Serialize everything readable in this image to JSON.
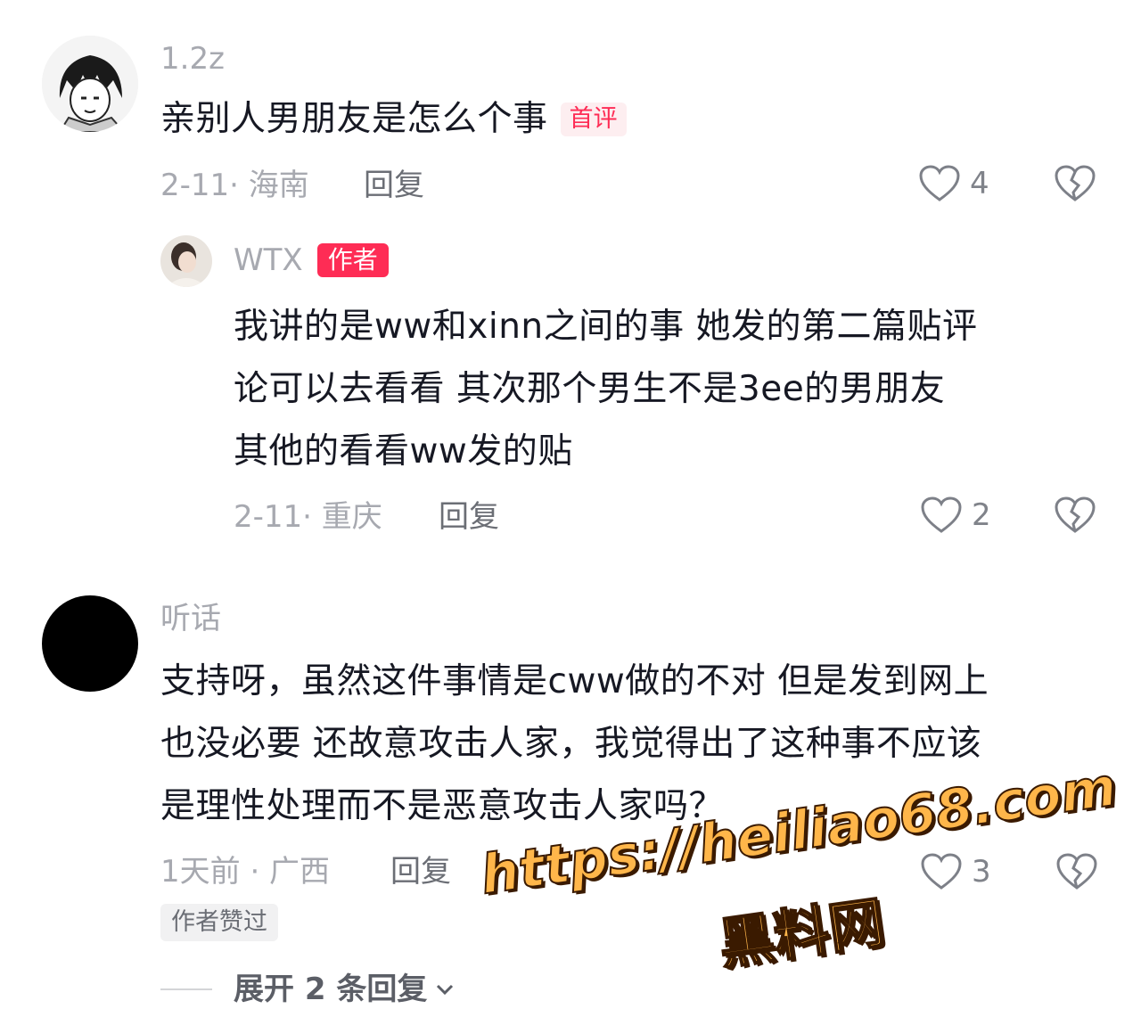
{
  "comments": [
    {
      "username": "1.2z",
      "text": "亲别人男朋友是怎么个事",
      "tag": "首评",
      "meta": "2-11· 海南",
      "reply_label": "回复",
      "likes": "4",
      "reply": {
        "username": "WTX",
        "author_tag": "作者",
        "lines": [
          "我讲的是ww和xinn之间的事  她发的第二篇贴评",
          "论可以去看看  其次那个男生不是3ee的男朋友",
          "其他的看看ww发的贴"
        ],
        "meta": "2-11· 重庆",
        "reply_label": "回复",
        "likes": "2"
      }
    },
    {
      "username": "听话",
      "lines": [
        "支持呀，虽然这件事情是cww做的不对 但是发到网上",
        "也没必要 还故意攻击人家，我觉得出了这种事不应该",
        "是理性处理而不是恶意攻击人家吗？"
      ],
      "meta": "1天前 · 广西",
      "reply_label": "回复",
      "likes": "3",
      "author_liked": "作者赞过",
      "expand_label": "展开 2 条回复"
    }
  ],
  "watermark": {
    "url": "https://heiliao68.com",
    "name": "黑料网"
  },
  "colors": {
    "accent": "#fe2c55",
    "gray_text": "#a7a9b0",
    "watermark": "#ffb64a"
  }
}
